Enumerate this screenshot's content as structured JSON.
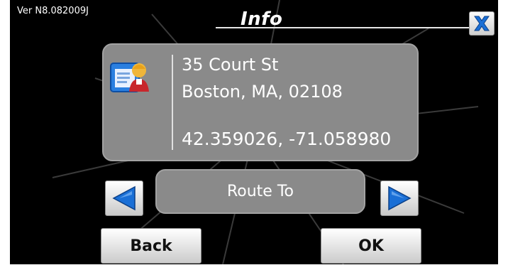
{
  "header": {
    "version": "Ver N8.082009J",
    "title": "Info"
  },
  "contact": {
    "icon": "contact-card-icon",
    "street": "35 Court St",
    "city_state_zip": "Boston, MA, 02108",
    "coordinates": "42.359026, -71.058980"
  },
  "navigation": {
    "prev_icon": "arrow-left-icon",
    "next_icon": "arrow-right-icon",
    "route_label": "Route To"
  },
  "footer": {
    "back_label": "Back",
    "ok_label": "OK"
  },
  "colors": {
    "panel": "#8a8a8a",
    "accent_blue": "#1a6fd6",
    "background": "#000000"
  }
}
